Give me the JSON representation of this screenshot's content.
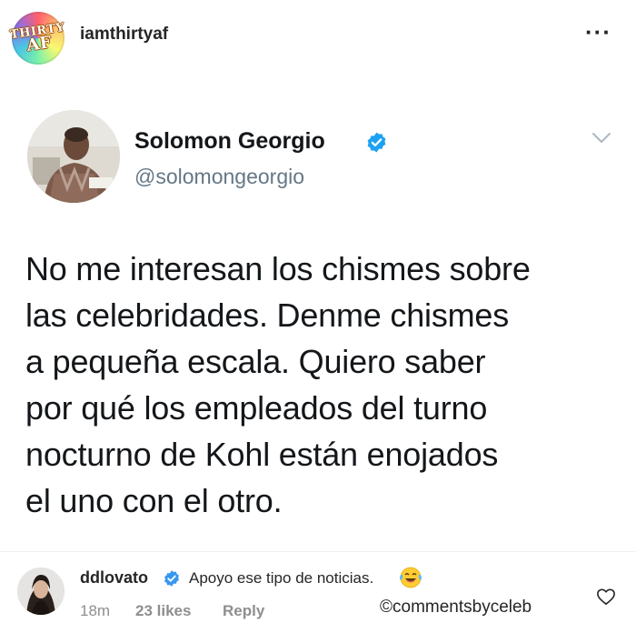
{
  "header": {
    "username": "iamthirtyaf",
    "avatar_text_top": "THIRTY",
    "avatar_text_bottom": "AF",
    "more_icon": "more-horizontal-icon"
  },
  "tweet": {
    "name": "Solomon Georgio",
    "handle": "@solomongeorgio",
    "verified_icon": "verified-badge-icon",
    "menu_icon": "chevron-down-icon",
    "text": "No me interesan los chismes sobre\nlas celebridades. Denme chismes\na pequeña escala. Quiero saber\npor qué los empleados del turno\nnocturno de Kohl están enojados\nel uno con el otro."
  },
  "comment": {
    "username": "ddlovato",
    "text": "Apoyo ese tipo de noticias.",
    "emoji": "laughing-emoji-icon",
    "time": "18m",
    "likes": "23 likes",
    "reply_label": "Reply",
    "credit": "©commentsbyceleb",
    "like_icon": "heart-icon"
  },
  "colors": {
    "verified_blue": "#1da1f2",
    "text_dark": "#14171a",
    "handle_gray": "#657786",
    "meta_gray": "#8e8e8e"
  }
}
